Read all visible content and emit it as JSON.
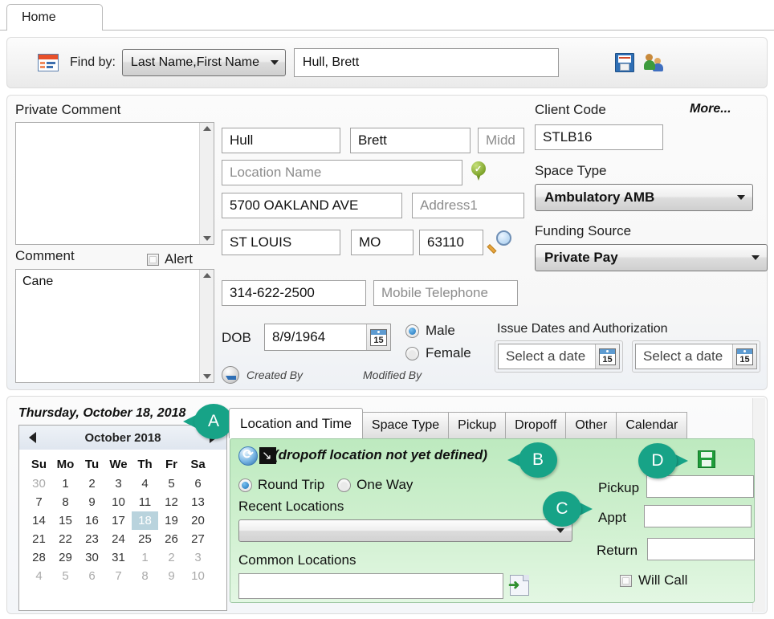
{
  "window": {
    "tab_label": "Home"
  },
  "findbar": {
    "calendar_icon": "calendar-icon",
    "find_by_label": "Find by:",
    "find_by_value": "Last Name,First Name",
    "search_value": "Hull, Brett",
    "save_icon": "floppy-save-icon",
    "people_icon": "people-icon"
  },
  "client": {
    "private_comment_label": "Private Comment",
    "private_comment_value": "",
    "comment_label": "Comment",
    "alert_label": "Alert",
    "alert_checked": false,
    "comment_value": "Cane",
    "last_name": "Hull",
    "first_name": "Brett",
    "middle_placeholder": "Midd",
    "middle_value": "",
    "location_name_placeholder": "Location Name",
    "location_name_value": "",
    "address": "5700 OAKLAND AVE",
    "address1_placeholder": "Address1",
    "address1_value": "",
    "city": "ST LOUIS",
    "state": "MO",
    "zip": "63110",
    "telephone": "314-622-2500",
    "mobile_placeholder": "Mobile Telephone",
    "mobile_value": "",
    "dob_label": "DOB",
    "dob_value": "8/9/1964",
    "gender_male": "Male",
    "gender_female": "Female",
    "gender_selected": "Male",
    "created_by_label": "Created By",
    "modified_by_label": "Modified By",
    "client_code_label": "Client Code",
    "more_label": "More...",
    "client_code_value": "STLB16",
    "space_type_label": "Space Type",
    "space_type_value": "Ambulatory AMB",
    "funding_source_label": "Funding Source",
    "funding_source_value": "Private Pay",
    "issue_dates_label": "Issue Dates and Authorization",
    "issue_date_1": "Select a date",
    "issue_date_2": "Select a date"
  },
  "schedule": {
    "selected_date_long": "Thursday, October 18, 2018",
    "calendar": {
      "month_label": "October 2018",
      "prev_icon": "left-arrow-icon",
      "next_icon": "right-arrow-icon",
      "day_headers": [
        "Su",
        "Mo",
        "Tu",
        "We",
        "Th",
        "Fr",
        "Sa"
      ],
      "weeks": [
        [
          {
            "d": "30",
            "m": true
          },
          {
            "d": "1"
          },
          {
            "d": "2"
          },
          {
            "d": "3"
          },
          {
            "d": "4"
          },
          {
            "d": "5"
          },
          {
            "d": "6"
          }
        ],
        [
          {
            "d": "7"
          },
          {
            "d": "8"
          },
          {
            "d": "9"
          },
          {
            "d": "10"
          },
          {
            "d": "11"
          },
          {
            "d": "12"
          },
          {
            "d": "13"
          }
        ],
        [
          {
            "d": "14"
          },
          {
            "d": "15"
          },
          {
            "d": "16"
          },
          {
            "d": "17"
          },
          {
            "d": "18",
            "s": true
          },
          {
            "d": "19"
          },
          {
            "d": "20"
          }
        ],
        [
          {
            "d": "21"
          },
          {
            "d": "22"
          },
          {
            "d": "23"
          },
          {
            "d": "24"
          },
          {
            "d": "25"
          },
          {
            "d": "26"
          },
          {
            "d": "27"
          }
        ],
        [
          {
            "d": "28"
          },
          {
            "d": "29"
          },
          {
            "d": "30"
          },
          {
            "d": "31"
          },
          {
            "d": "1",
            "m": true
          },
          {
            "d": "2",
            "m": true
          },
          {
            "d": "3",
            "m": true
          }
        ],
        [
          {
            "d": "4",
            "m": true
          },
          {
            "d": "5",
            "m": true
          },
          {
            "d": "6",
            "m": true
          },
          {
            "d": "7",
            "m": true
          },
          {
            "d": "8",
            "m": true
          },
          {
            "d": "9",
            "m": true
          },
          {
            "d": "10",
            "m": true
          }
        ]
      ]
    },
    "tabs": [
      {
        "label": "Location and Time",
        "active": true
      },
      {
        "label": "Space Type",
        "active": false
      },
      {
        "label": "Pickup",
        "active": false
      },
      {
        "label": "Dropoff",
        "active": false
      },
      {
        "label": "Other",
        "active": false
      },
      {
        "label": "Calendar",
        "active": false
      }
    ],
    "trip": {
      "status_text": "(dropoff location not yet defined)",
      "refresh_icon": "refresh-icon",
      "map_arrow_icon": "map-arrow-icon",
      "round_trip_label": "Round Trip",
      "one_way_label": "One Way",
      "trip_type_selected": "Round Trip",
      "recent_locations_label": "Recent Locations",
      "recent_locations_value": "",
      "common_locations_label": "Common Locations",
      "common_locations_value": "",
      "add_location_icon": "add-document-icon",
      "save_icon": "green-floppy-save-icon",
      "pickup_label": "Pickup",
      "pickup_value": "",
      "appt_label": "Appt",
      "appt_value": "",
      "return_label": "Return",
      "return_value": "",
      "will_call_label": "Will Call",
      "will_call_checked": false
    }
  },
  "callouts": [
    {
      "letter": "A",
      "dir": "left"
    },
    {
      "letter": "B",
      "dir": "left"
    },
    {
      "letter": "C",
      "dir": "right"
    },
    {
      "letter": "D",
      "dir": "right"
    }
  ],
  "colors": {
    "callout": "#17a387",
    "panel_green": "#bdeabf",
    "selected_day": "#b9d3dd"
  }
}
